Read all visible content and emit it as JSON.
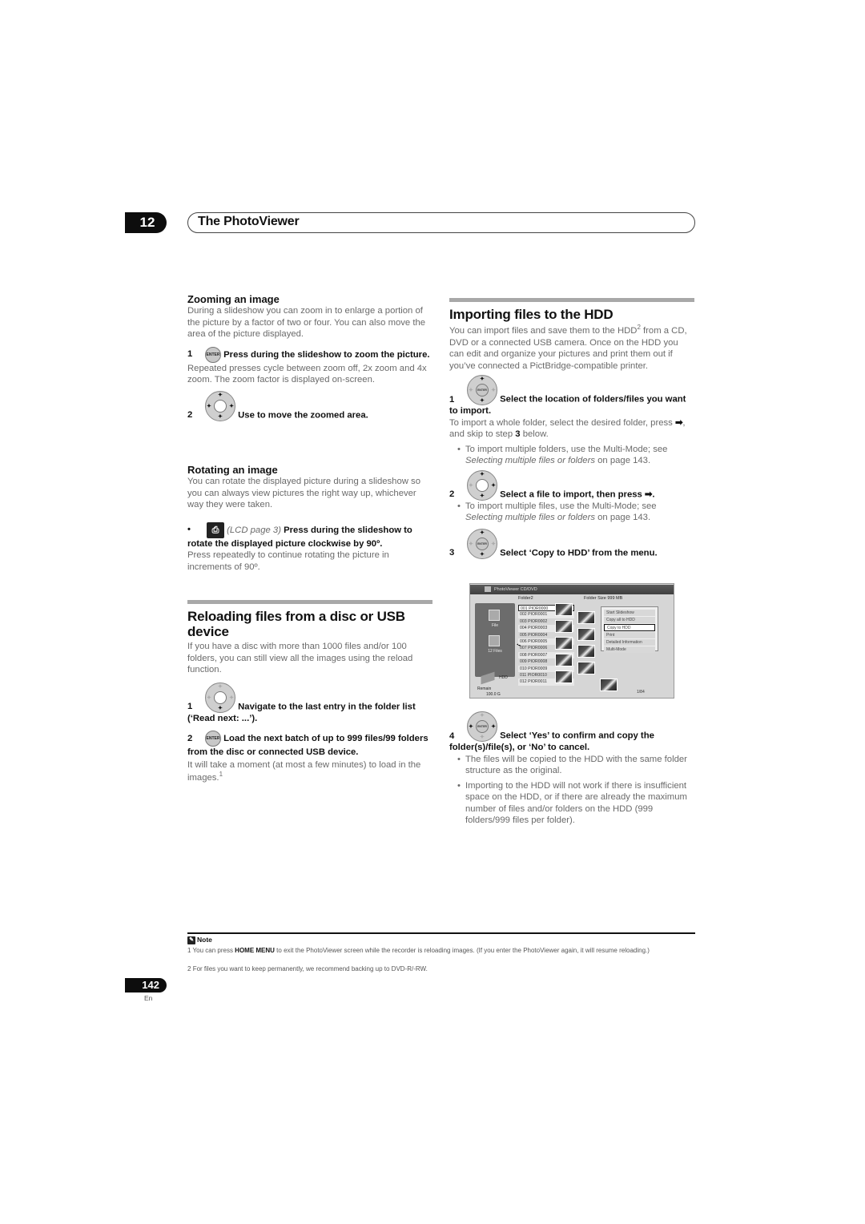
{
  "chapter": {
    "number": "12",
    "title": "The PhotoViewer"
  },
  "left": {
    "zoom": {
      "heading": "Zooming an image",
      "intro": "During a slideshow you can zoom in to enlarge a portion of the picture by a factor of two or four. You can also move the area of the picture displayed.",
      "steps": [
        {
          "num": "1",
          "icon": "enter-button-icon",
          "text": "Press during the slideshow to zoom the picture.",
          "desc": "Repeated presses cycle between zoom off, 2x zoom and 4x zoom. The zoom factor is displayed on-screen."
        },
        {
          "num": "2",
          "icon": "direction-pad-icon",
          "text": "Use to move the zoomed area."
        }
      ]
    },
    "rotate": {
      "heading": "Rotating an image",
      "intro": "You can rotate the displayed picture during a slideshow so you can always view pictures the right way up, whichever way they were taken.",
      "bullet_ref": "(LCD page 3)",
      "bullet_text": "Press during the slideshow to rotate the displayed picture clockwise by 90º.",
      "bullet_desc": "Press repeatedly to continue rotating the picture in increments of 90º."
    },
    "reload": {
      "heading": "Reloading files from a disc or USB device",
      "intro": "If you have a disc with more than 1000 files and/or 100 folders, you can still view all the images using the reload function.",
      "steps": [
        {
          "num": "1",
          "icon": "direction-pad-icon",
          "text": "Navigate to the last entry in the folder list (‘Read next: ...’)."
        },
        {
          "num": "2",
          "icon": "enter-button-icon",
          "text": "Load the next batch of up to 999 files/99 folders from the disc or connected USB device.",
          "desc": "It will take a moment (at most a few minutes) to load in the images.",
          "footnote_ref": "1"
        }
      ]
    }
  },
  "right": {
    "import": {
      "heading": "Importing files to the HDD",
      "intro_a": "You can import files and save them to the HDD",
      "intro_ref": "2",
      "intro_b": " from a CD, DVD or a connected USB camera. Once on the HDD you can edit and organize your pictures and print them out if you’ve connected a PictBridge-compatible printer.",
      "step1": {
        "num": "1",
        "text": "Select the location of folders/files you want to import.",
        "desc_a": "To import a whole folder, select the desired folder, press ",
        "desc_arrow": "➡",
        "desc_b": ", and skip to step ",
        "desc_step": "3",
        "desc_c": " below.",
        "bullet_a": "To import multiple folders, use the Multi-Mode; see ",
        "bullet_link": "Selecting multiple files or folders",
        "bullet_b": " on page 143."
      },
      "step2": {
        "num": "2",
        "text": "Select a file to import, then press ➡.",
        "bullet_a": "To import multiple files, use the Multi-Mode; see ",
        "bullet_link": "Selecting multiple files or folders",
        "bullet_b": " on page 143."
      },
      "step3": {
        "num": "3",
        "text": "Select ‘Copy to HDD’ from the menu."
      },
      "step4": {
        "num": "4",
        "text": "Select ‘Yes’ to confirm and copy the folder(s)/file(s), or ‘No’ to cancel.",
        "bullets": [
          "The files will be copied to the HDD with the same folder structure as the original.",
          "Importing to the HDD will not work if there is insufficient space on the HDD, or if there are already the maximum number of files and/or folders on the HDD (999 folders/999 files per folder)."
        ]
      }
    },
    "screen": {
      "title": "PhotoViewer  CD/DVD",
      "folder": "Folder2",
      "folder_size": "Folder Size 999 MB",
      "side_file_label": "File",
      "side_files_count": "12 Files",
      "hdd_label": "HDD",
      "remain_label": "Remain",
      "remain_value": "100.0 G",
      "files": [
        "001  PIOR0000",
        "002  PIOR0001",
        "003  PIOR0002",
        "004  PIOR0003",
        "005  PIOR0004",
        "006  PIOR0005",
        "007  PIOR0006",
        "008  PIOR0007",
        "009  PIOR0008",
        "010  PIOR0009",
        "011  PIOR0010",
        "012  PIOR0011"
      ],
      "menu": [
        "Start Slideshow",
        "Copy all to HDD",
        "Copy to HDD",
        "Print",
        "Detailed Information",
        "Multi-Mode"
      ],
      "menu_selected": "Copy to HDD",
      "page": "1/84"
    }
  },
  "notes": {
    "header": "Note",
    "items": [
      {
        "num": "1",
        "a": "You can press ",
        "bold": "HOME MENU",
        "b": " to exit the PhotoViewer screen while the recorder is reloading images. (If you enter the PhotoViewer again, it will resume reloading.)"
      },
      {
        "num": "2",
        "a": "For files you want to keep permanently, we recommend backing up to DVD-R/-RW."
      }
    ]
  },
  "footer": {
    "page_number": "142",
    "language": "En"
  }
}
